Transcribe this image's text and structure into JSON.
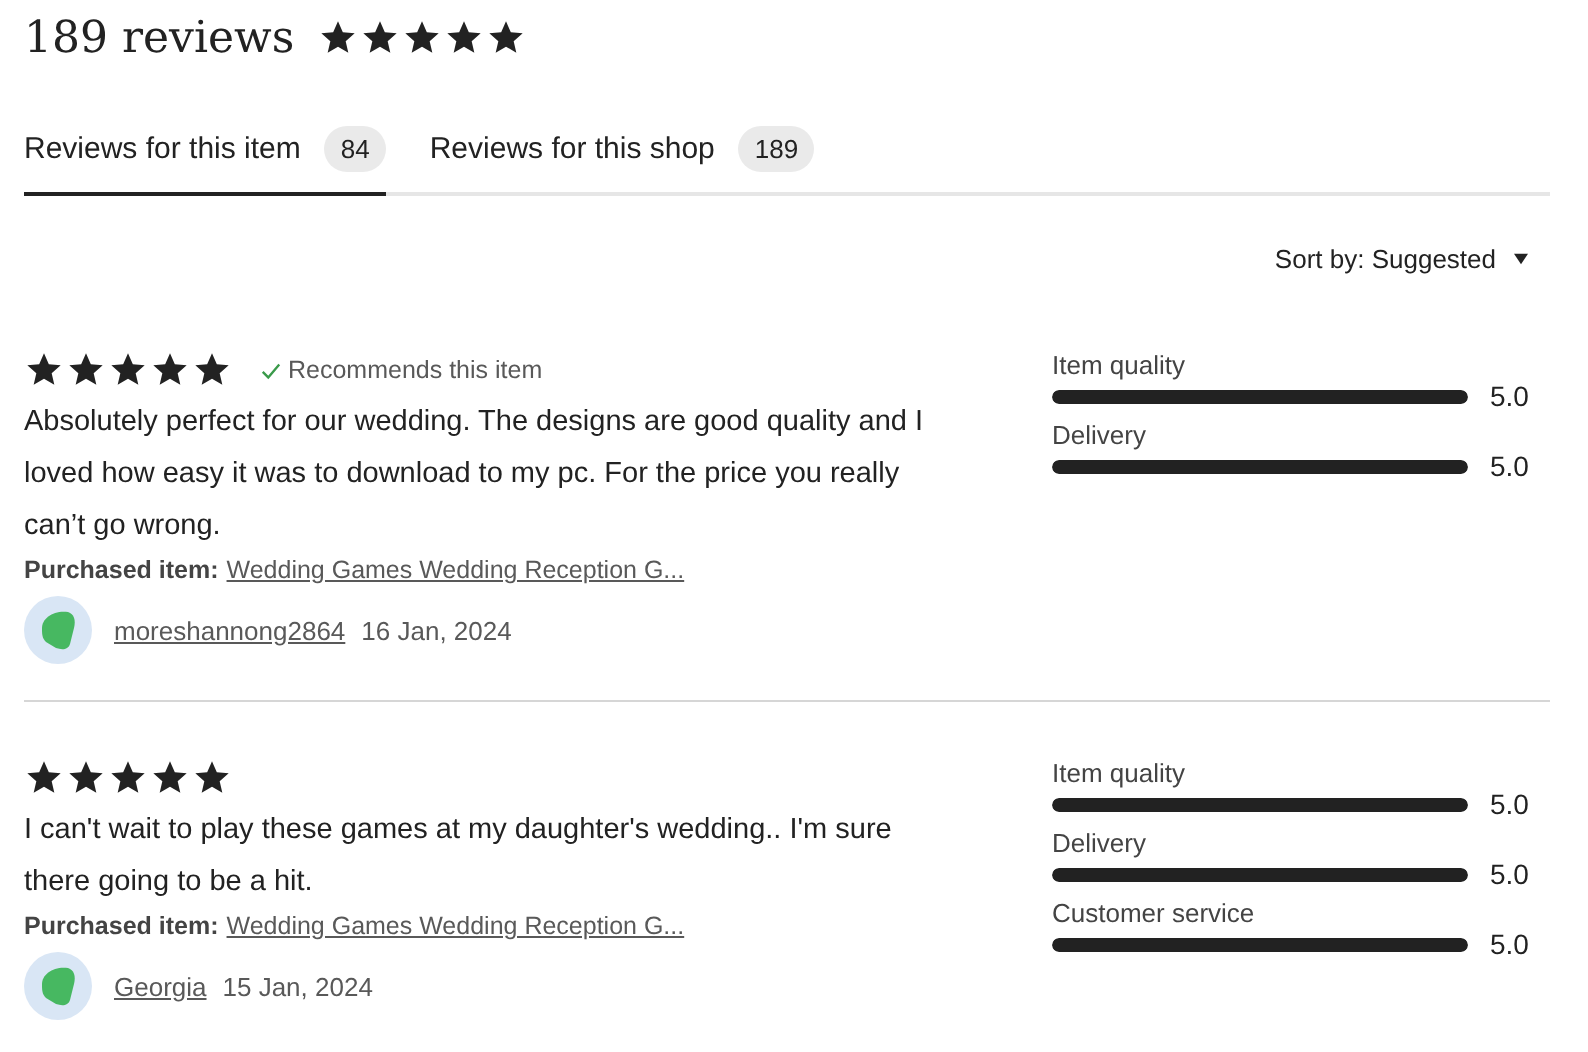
{
  "header": {
    "title": "189 reviews",
    "stars": 5
  },
  "tabs": [
    {
      "label": "Reviews for this item",
      "count": "84",
      "selected": true
    },
    {
      "label": "Reviews for this shop",
      "count": "189",
      "selected": false
    }
  ],
  "sort": {
    "label": "Sort by: Suggested"
  },
  "reviews": [
    {
      "stars": 5,
      "recommendation": "Recommends this item",
      "text": "Absolutely perfect for our wedding. The designs are good quality and I loved how easy it was to download to my pc. For the price you really can’t go wrong.",
      "purchased_label": "Purchased item:",
      "purchased_item": "Wedding Games Wedding Reception G...",
      "author": "moreshannong2864",
      "date": "16 Jan, 2024",
      "ratings": [
        {
          "label": "Item quality",
          "level": 1,
          "value": "5.0"
        },
        {
          "label": "Delivery",
          "level": 1,
          "value": "5.0"
        }
      ]
    },
    {
      "stars": 5,
      "text": "I can't wait to play these games at my daughter's wedding.. I'm sure there going to be a hit.",
      "purchased_label": "Purchased item:",
      "purchased_item": "Wedding Games Wedding Reception G...",
      "author": "Georgia",
      "date": "15 Jan, 2024",
      "ratings": [
        {
          "label": "Item quality",
          "level": 1,
          "value": "5.0"
        },
        {
          "label": "Delivery",
          "level": 1,
          "value": "5.0"
        },
        {
          "label": "Customer service",
          "level": 1,
          "value": "5.0"
        }
      ]
    }
  ]
}
